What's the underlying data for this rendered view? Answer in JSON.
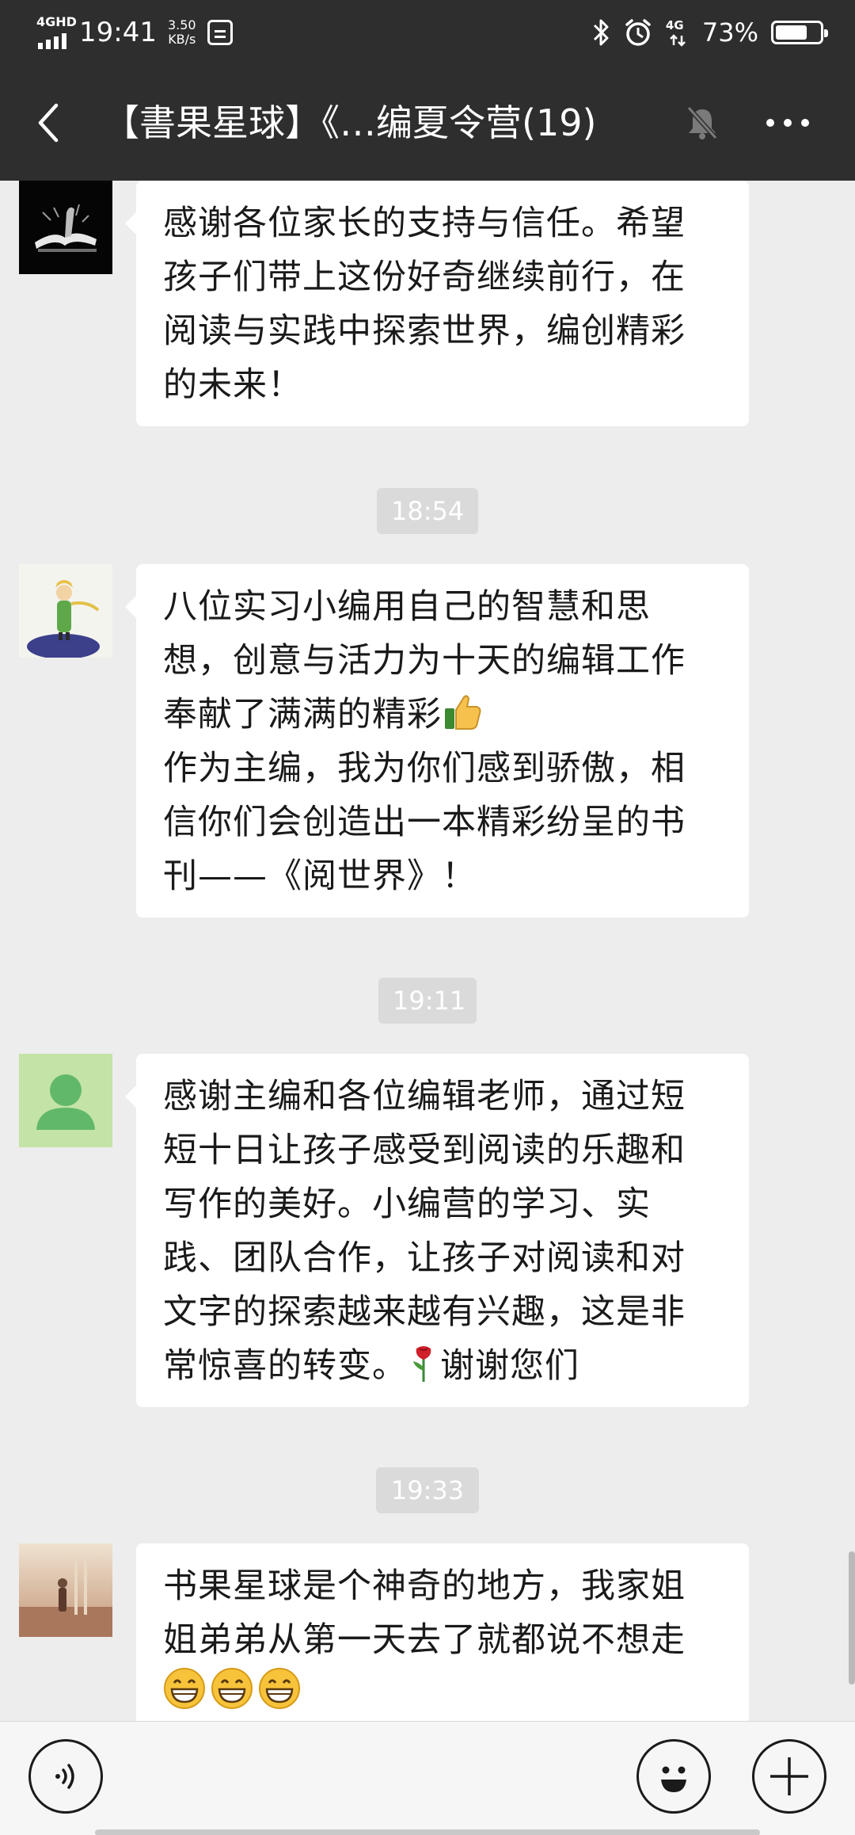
{
  "status_bar": {
    "network_label": "4GHD",
    "time": "19:41",
    "speed_value": "3.50",
    "speed_unit": "KB/s",
    "cell_label": "4G",
    "battery_percent": "73%",
    "battery_level": 0.73,
    "icons": [
      "bluetooth-icon",
      "alarm-icon",
      "signal-icon",
      "battery-icon"
    ]
  },
  "header": {
    "title": "【書果星球】《…编夏令营(19)",
    "icons": [
      "back-arrow-icon",
      "mute-bell-icon",
      "more-dots-icon"
    ]
  },
  "messages": [
    {
      "type": "text",
      "lines": [
        "感谢各位家长的支持与信任。希望",
        "孩子们带上这份好奇继续前行，在",
        "阅读与实践中探索世界，编创精彩",
        "的未来！"
      ]
    },
    {
      "type": "time",
      "text": "18:54"
    },
    {
      "type": "text",
      "lines": [
        "八位实习小编用自己的智慧和思",
        "想，创意与活力为十天的编辑工作",
        "奉献了满满的精彩",
        "作为主编，我为你们感到骄傲，相",
        "信你们会创造出一本精彩纷呈的书",
        "刊——《阅世界》！"
      ],
      "emoji": "thumbs-up"
    },
    {
      "type": "time",
      "text": "19:11"
    },
    {
      "type": "text",
      "lines": [
        "感谢主编和各位编辑老师，通过短",
        "短十日让孩子感受到阅读的乐趣和",
        "写作的美好。小编营的学习、实",
        "践、团队合作，让孩子对阅读和对",
        "文字的探索越来越有兴趣，这是非",
        "常惊喜的转变。",
        "谢谢您们"
      ],
      "emoji": "rose"
    },
    {
      "type": "time",
      "text": "19:33"
    },
    {
      "type": "text",
      "lines": [
        "书果星球是个神奇的地方，我家姐",
        "姐弟弟从第一天去了就都说不想走"
      ],
      "emoji": "grinning-face x3"
    }
  ],
  "input_bar": {
    "icons": [
      "voice-icon",
      "emoji-icon",
      "plus-icon"
    ],
    "input_value": ""
  },
  "colors": {
    "header_bg": "#2e2e2e",
    "chat_bg": "#ededed",
    "bubble_bg": "#ffffff",
    "timestamp_bg": "#dadada"
  }
}
